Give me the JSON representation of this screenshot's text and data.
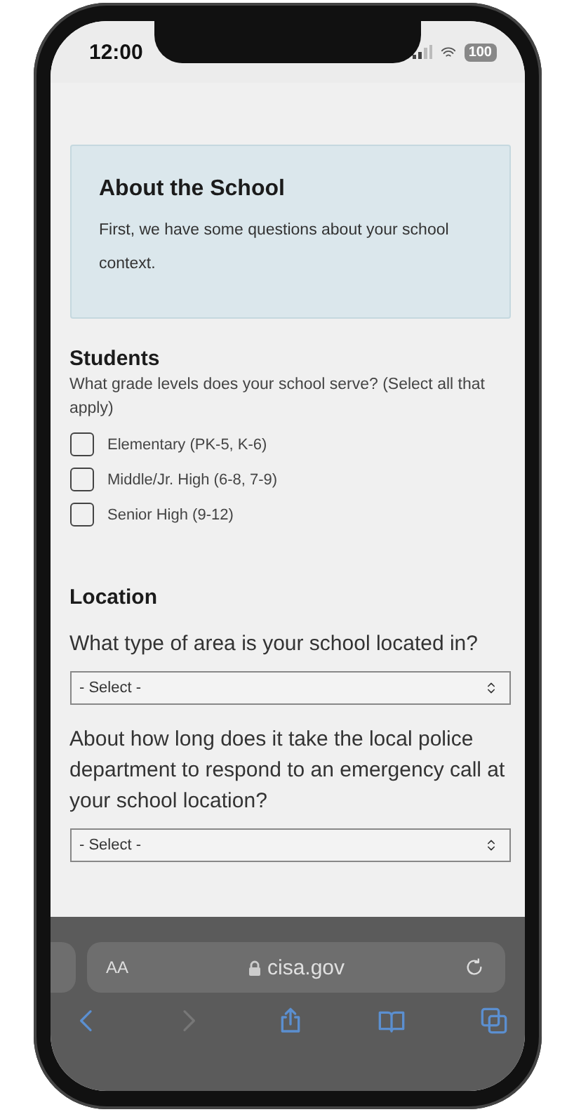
{
  "status_bar": {
    "time": "12:00",
    "battery": "100"
  },
  "intro_card": {
    "title": "About the School",
    "text": "First, we have some questions about your school context."
  },
  "students": {
    "heading": "Students",
    "question": "What grade levels does your school serve? (Select all that apply)",
    "options": [
      {
        "label": "Elementary (PK-5, K-6)",
        "checked": false
      },
      {
        "label": "Middle/Jr. High (6-8, 7-9)",
        "checked": false
      },
      {
        "label": "Senior High (9-12)",
        "checked": false
      }
    ]
  },
  "location": {
    "heading": "Location",
    "questions": [
      {
        "question": "What type of area is your school located in?",
        "placeholder": "- Select -"
      },
      {
        "question": "About how long does it take the local police department to respond to an emergency call at your school location?",
        "placeholder": "- Select -"
      }
    ]
  },
  "browser": {
    "text_size": "AA",
    "url": "cisa.gov",
    "toolbar": [
      {
        "kind": "back",
        "disabled": false
      },
      {
        "kind": "forward",
        "disabled": true
      },
      {
        "kind": "share",
        "disabled": false
      },
      {
        "kind": "bookmarks",
        "disabled": false
      },
      {
        "kind": "tabs",
        "disabled": false
      }
    ]
  }
}
